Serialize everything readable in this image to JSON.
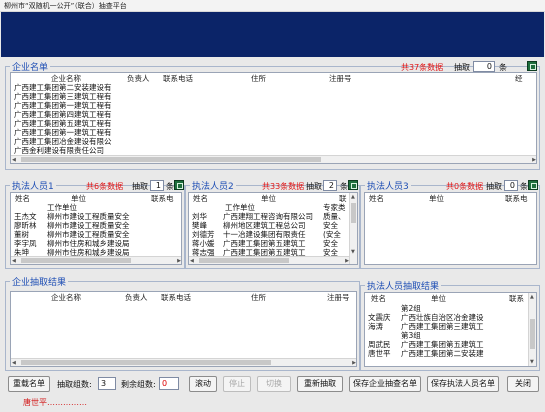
{
  "window_title": "柳州市“双随机一公开”（联合）抽查平台",
  "company_list": {
    "legend": "企业名单",
    "count_text": "共37条数据",
    "draw_label": "抽取",
    "draw_value": "0",
    "draw_unit": "条",
    "columns": [
      "企业名称",
      "负责人",
      "联系电话",
      "住所",
      "注册号",
      "经"
    ],
    "rows": [
      "广西建工集团第二安装建设有",
      "广西建工集团第三建筑工程有",
      "广西建工集团第一建筑工程有",
      "广西建工集团第四建筑工程有",
      "广西建工集团第五建筑工程有",
      "广西建工集团第一建筑工程有",
      "广西建工集团冶金建设有限公",
      "广西金利建设有限责任公司"
    ]
  },
  "inspectors_1": {
    "legend": "执法人员1",
    "count_text": "共6条数据",
    "draw_label": "抽取",
    "draw_value": "1",
    "draw_unit": "条",
    "columns": [
      "姓名",
      "单位",
      "联系电"
    ],
    "sub_columns": [
      "",
      "工作单位",
      ""
    ],
    "rows": [
      [
        "王杰文",
        "柳州市建设工程质量安全"
      ],
      [
        "廖昕林",
        "柳州市建设工程质量安全"
      ],
      [
        "董树",
        "柳州市建设工程质量安全"
      ],
      [
        "李宇凤",
        "柳州市住房和城乡建设局"
      ],
      [
        "朱坤",
        "柳州市住房和城乡建设局"
      ]
    ]
  },
  "inspectors_2": {
    "legend": "执法人员2",
    "count_text": "共33条数据",
    "draw_label": "抽取",
    "draw_value": "2",
    "draw_unit": "条",
    "columns": [
      "姓名",
      "单位",
      "联"
    ],
    "sub_columns": [
      "",
      "工作单位",
      "专家类"
    ],
    "rows": [
      [
        "刘华",
        "广西建翔工程咨询有限公司",
        "质量、"
      ],
      [
        "樊峰",
        "柳州地区建筑工程总公司",
        "安全"
      ],
      [
        "刘德芳",
        "十一冶建设集团有限责任",
        "(安全"
      ],
      [
        "蒋小媛",
        "广西建工集团第五建筑工",
        "安全"
      ],
      [
        "蒋志强",
        "广西建工集团第五建筑工",
        "安全"
      ]
    ]
  },
  "inspectors_3": {
    "legend": "执法人员3",
    "count_text": "共0条数据",
    "draw_label": "抽取",
    "draw_value": "0",
    "draw_unit": "条",
    "columns": [
      "姓名",
      "单位",
      "联系电"
    ]
  },
  "company_result": {
    "legend": "企业抽取结果",
    "columns": [
      "企业名称",
      "负责人",
      "联系电话",
      "住所",
      "注册号"
    ]
  },
  "inspector_result": {
    "legend": "执法人员抽取结果",
    "columns": [
      "姓名",
      "单位",
      "联系"
    ],
    "rows": [
      [
        "",
        "第2组"
      ],
      [
        "文震庆",
        "广西壮族自治区冶金建设"
      ],
      [
        "海涛",
        "广西建工集团第三建筑工"
      ],
      [
        "",
        "第3组"
      ],
      [
        "周武民",
        "广西建工集团第五建筑工"
      ],
      [
        "唐世平",
        "广西建工集团第二安装建"
      ]
    ]
  },
  "toolbar": {
    "reload_label": "重载名单",
    "groups_label": "抽取组数:",
    "groups_value": "3",
    "remaining_label": "剩余组数:",
    "remaining_value": "0",
    "roll_label": "滚动",
    "stop_label": "停止",
    "switch_label": "切换",
    "redraw_label": "重新抽取",
    "save_company_label": "保存企业抽查名单",
    "save_inspector_label": "保存执法人员名单",
    "close_label": "关闭"
  },
  "footer_text": "唐世平……………"
}
